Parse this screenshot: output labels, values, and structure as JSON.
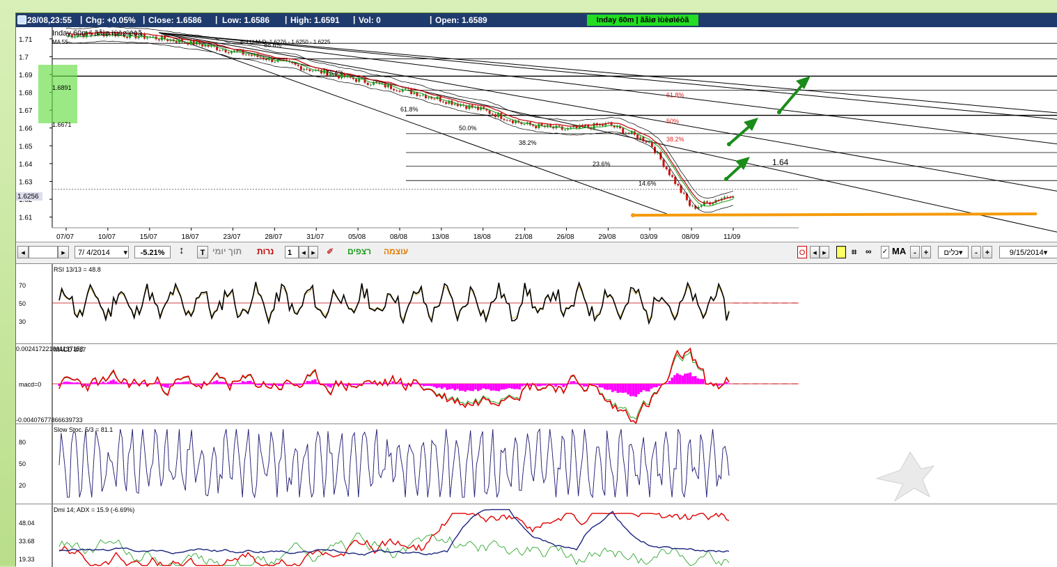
{
  "infobar": {
    "datetime": "28/08,23:55",
    "chg": "Chg: +0.05%",
    "close": "Close: 1.6586",
    "low": "Low: 1.6586",
    "high": "High: 1.6591",
    "vol": "Vol: 0",
    "open": "Open: 1.6589",
    "badge": "Inday 60m | ãåìø ìùèøìéòã"
  },
  "main_chart": {
    "title": "Inday 60m | ãåìø ìùèøìéòã",
    "ma_label": "MA 55",
    "bol_label": "Bol U-M-D: 1.6276 - 1.6250 - 1.6225",
    "range_box": {
      "top": "1.6891",
      "bottom": "1.6671"
    },
    "price_tag": "1.6256",
    "forecast_label": "1.64"
  },
  "chart_data": [
    {
      "type": "line",
      "title": "Inday 60m",
      "x": [
        "07/07",
        "10/07",
        "15/07",
        "18/07",
        "23/07",
        "28/07",
        "31/07",
        "05/08",
        "08/08",
        "13/08",
        "18/08",
        "21/08",
        "26/08",
        "29/08",
        "03/09",
        "08/09",
        "11/09"
      ],
      "y_ticks": [
        1.71,
        1.7,
        1.69,
        1.68,
        1.67,
        1.66,
        1.65,
        1.64,
        1.63,
        1.62,
        1.61
      ],
      "ylim": [
        1.604,
        1.715
      ],
      "series": [
        {
          "values": [
            1.712,
            1.713,
            1.711,
            1.708,
            1.703,
            1.698,
            1.692,
            1.687,
            1.682,
            1.676,
            1.67,
            1.662,
            1.659,
            1.662,
            1.652,
            1.615,
            1.623
          ]
        }
      ],
      "fib_levels_left": [
        "88.6%",
        "76.4%",
        "61.8%",
        "50.0%",
        "38.2%",
        "23.6%",
        "14.6%"
      ],
      "fib_levels_right": [
        "61.8%",
        "50%",
        "38.2%"
      ],
      "support_level": 1.6115
    },
    {
      "type": "line",
      "title": "RSI 13/13 = 48.8",
      "y_ticks": [
        70,
        50,
        30
      ],
      "ylim": [
        10,
        90
      ]
    },
    {
      "type": "bar",
      "title": "MACD 8/17",
      "y_ticks": [
        "0.002417221001137158",
        "macd=0",
        "-0.00407677866639733"
      ]
    },
    {
      "type": "line",
      "title": "Slow Stoc. 5/3 = 81.1",
      "y_ticks": [
        80,
        50,
        20
      ],
      "ylim": [
        0,
        100
      ]
    },
    {
      "type": "line",
      "title": "Dmi 14; ADX = 15.9 (-6.69%)",
      "y_ticks": [
        48.04,
        33.68,
        19.33
      ],
      "ylim": [
        15,
        60
      ]
    }
  ],
  "toolbar": {
    "date_field": "7/  4/2014",
    "pct": "-5.21%",
    "t_label": "T",
    "tool_yomi": "תוך יומי",
    "narot": "נרות",
    "count": "1",
    "retzifim": "רצפים",
    "otzma": "עוצמה",
    "o_label": "O",
    "ma_label": "MA",
    "klim": "כלים",
    "end_date": "9/15/2014",
    "colors": {
      "retzifim": "#1a9c1a",
      "otzma": "#e07b00",
      "narot": "#c00000"
    }
  },
  "colors": {
    "infobar_bg": "#1f3b6d",
    "badge": "#22dd22",
    "arrow": "#1a8c1a",
    "support": "#f59a0a"
  }
}
